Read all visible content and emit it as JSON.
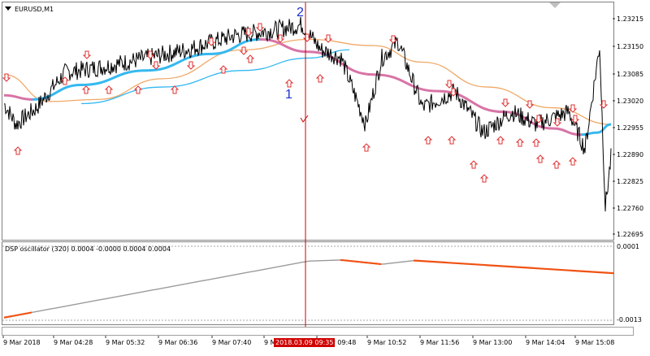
{
  "chart_title": "EURUSD,M1",
  "oscillator_title": "DSP oscillator (320) 0.0004 -0.0000 0.0004 0.0004",
  "markers": {
    "top": "2",
    "bottom": "1"
  },
  "cursor_time": "2018.03.09 09:35",
  "price_ticks": [
    "1.23215",
    "1.23150",
    "1.23085",
    "1.23020",
    "1.22955",
    "1.22890",
    "1.22825",
    "1.22760",
    "1.22695"
  ],
  "osc_ticks": [
    "0.0001",
    "-0.0013"
  ],
  "time_ticks": [
    "9 Mar 2018",
    "9 Mar 04:28",
    "9 Mar 05:32",
    "9 Mar 06:36",
    "9 Mar 07:40",
    "9 Mar 08:44",
    "9 Mar 09:48",
    "9 Mar 10:52",
    "9 Mar 11:56",
    "9 Mar 13:00",
    "9 Mar 14:04",
    "9 Mar 15:08"
  ],
  "colors": {
    "price": "#000000",
    "dsp_up": "#35b8f0",
    "dsp_down": "#d874a6",
    "ma": "#f0a868",
    "arrows": "#e03030",
    "osc_flat": "#9a9a9a",
    "osc_down": "#f05010",
    "cursor": "#d00000",
    "markers": "#1a2fd6"
  },
  "chart_data": [
    {
      "type": "line",
      "title": "EURUSD,M1",
      "ylim": [
        1.22695,
        1.23215
      ],
      "x": [
        "9 Mar 2018",
        "9 Mar 04:28",
        "9 Mar 05:32",
        "9 Mar 06:36",
        "9 Mar 07:40",
        "9 Mar 08:44",
        "9 Mar 09:48",
        "9 Mar 10:52",
        "9 Mar 11:56",
        "9 Mar 13:00",
        "9 Mar 14:04",
        "9 Mar 15:08"
      ],
      "series": [
        {
          "name": "EURUSD,M1",
          "values": [
            1.22995,
            1.2308,
            1.231,
            1.2312,
            1.23165,
            1.23195,
            1.2313,
            1.2316,
            1.2302,
            1.2294,
            1.2296,
            1.228
          ]
        }
      ]
    },
    {
      "type": "line",
      "title": "DSP oscillator (320) 0.0004 -0.0000 0.0004 0.0004",
      "ylim": [
        -0.0013,
        0.0001
      ],
      "x": [
        "9 Mar 2018",
        "9 Mar 04:28",
        "9 Mar 05:32",
        "9 Mar 06:36",
        "9 Mar 07:40",
        "9 Mar 08:44",
        "9 Mar 09:48",
        "9 Mar 10:52",
        "9 Mar 11:56",
        "9 Mar 13:00",
        "9 Mar 14:04",
        "9 Mar 15:08"
      ],
      "series": [
        {
          "values": [
            -0.00125,
            -0.00112,
            -0.00092,
            -0.0007,
            -0.0005,
            -0.00032,
            -0.00018,
            -0.0001,
            -0.00016,
            -0.00025,
            -0.0003,
            -0.00035
          ]
        }
      ]
    }
  ]
}
